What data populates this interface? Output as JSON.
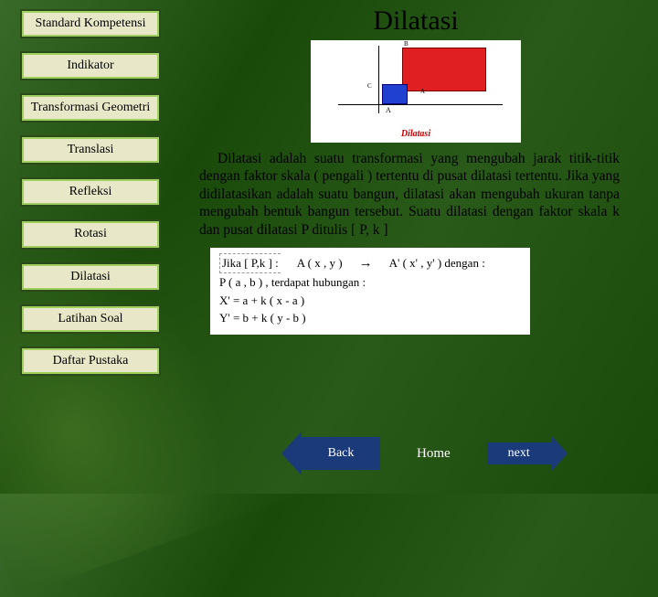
{
  "sidebar": {
    "items": [
      "Standard Kompetensi",
      "Indikator",
      "Transformasi Geometri",
      "Translasi",
      "Refleksi",
      "Rotasi",
      "Dilatasi",
      "Latihan Soal",
      "Daftar Pustaka"
    ]
  },
  "title": "Dilatasi",
  "graph": {
    "labelA": "A",
    "labelB": "B",
    "labelC": "C",
    "labelAr": "A",
    "caption": "Dilatasi"
  },
  "paragraph": "Dilatasi adalah suatu transformasi yang mengubah jarak titik-titik dengan faktor skala ( pengali ) tertentu di pusat dilatasi tertentu. Jika yang didilatasikan adalah suatu bangun, dilatasi akan mengubah ukuran tanpa mengubah bentuk bangun tersebut. Suatu dilatasi dengan faktor skala k dan pusat dilatasi P ditulis [ P, k ]",
  "formula": {
    "line1_left": "Jika [ P,k ] :",
    "line1_mid": "A ( x , y )",
    "line1_right": "A' ( x' , y' )  dengan :",
    "line2": "P  ( a , b ) ,    terdapat hubungan :",
    "line3": "X' = a + k ( x - a )",
    "line4": "Y' = b + k ( y - b )"
  },
  "footer": {
    "back": "Back",
    "home": "Home",
    "next": "next"
  }
}
